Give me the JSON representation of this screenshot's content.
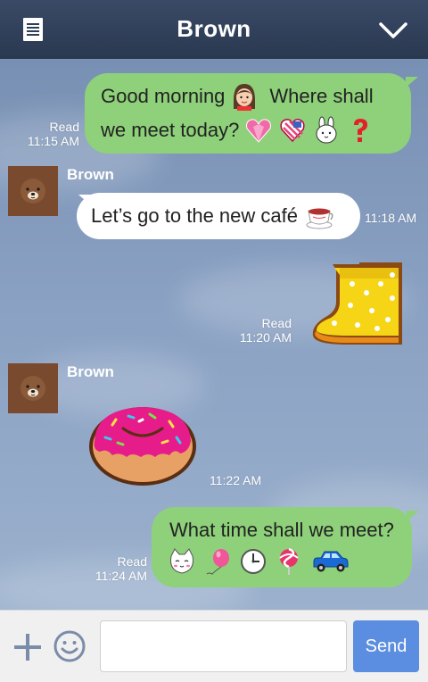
{
  "header": {
    "title": "Brown"
  },
  "messages": {
    "m1": {
      "line1": "Good morning",
      "line1b": "Where shall",
      "line2": "we meet today?",
      "read": "Read",
      "time": "11:15 AM"
    },
    "m2": {
      "sender": "Brown",
      "text": "Let’s go to the new café",
      "time": "11:18 AM"
    },
    "m3": {
      "read": "Read",
      "time": "11:20 AM"
    },
    "m4": {
      "sender": "Brown",
      "time": "11:22 AM"
    },
    "m5": {
      "text": "What time shall we meet?",
      "read": "Read",
      "time": "11:24 AM"
    }
  },
  "composer": {
    "input_value": "",
    "placeholder": "",
    "send_label": "Send"
  },
  "icons": {
    "menu": "list-icon",
    "chevron": "chevron-down-icon",
    "plus": "plus-icon",
    "emoji": "smiley-icon",
    "m1_emoji": [
      "girl-face-icon",
      "pink-heart-gem-icon",
      "striped-heart-icon",
      "bunny-face-icon",
      "question-mark-icon"
    ],
    "m2_emoji": [
      "tea-cup-icon"
    ],
    "m5_emoji": [
      "cat-face-icon",
      "balloon-icon",
      "clock-icon",
      "lollipop-icon",
      "blue-car-icon"
    ],
    "stickers": [
      "yellow-rain-boot-sticker",
      "pink-donut-sticker"
    ]
  },
  "colors": {
    "header": "#2f3d56",
    "outgoing_bubble": "#8ed17a",
    "incoming_bubble": "#ffffff",
    "send_button": "#5b8de0",
    "chat_bg": "#8aa1c3"
  }
}
